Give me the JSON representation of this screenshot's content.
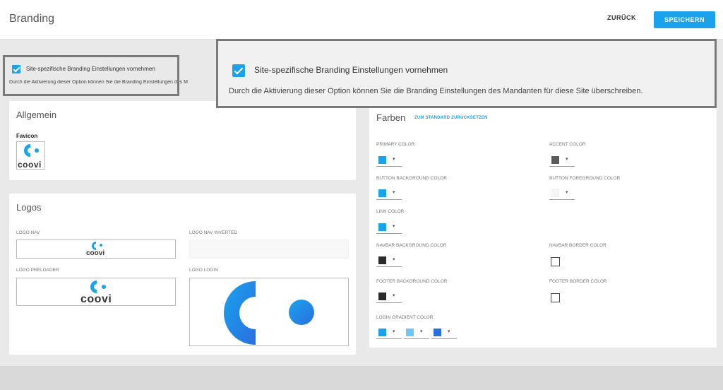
{
  "header": {
    "title": "Branding",
    "back_label": "ZURÜCK",
    "save_label": "SPEICHERN"
  },
  "option": {
    "label": "Site-spezifische Branding Einstellungen vornehmen",
    "desc_truncated": "Durch die Aktivierung dieser Option können Sie die Branding Einstellungen des M",
    "desc": "Durch die Aktivierung dieser Option können Sie die Branding Einstellungen des Mandanten für diese Site überschreiben.",
    "checked": true
  },
  "allgemein": {
    "title": "Allgemein",
    "favicon_label": "Favicon",
    "favicon_text": "coovi"
  },
  "logos": {
    "title": "Logos",
    "logo_nav_label": "LOGO NAV",
    "logo_nav_inverted_label": "LOGO NAV INVERTED",
    "logo_preloader_label": "LOGO PRELOADER",
    "logo_login_label": "LOGO LOGIN",
    "logo_text": "coovi"
  },
  "farben": {
    "title": "Farben",
    "reset_label": "ZUM STANDARD ZURÜCKSETZEN",
    "primary_label": "PRIMARY COLOR",
    "accent_label": "ACCENT COLOR",
    "button_bg_label": "BUTTON BACKGROUND COLOR",
    "button_fg_label": "BUTTON FOREGROUND COLOR",
    "link_label": "LINK COLOR",
    "navbar_bg_label": "NAVBAR BACKGROUND COLOR",
    "navbar_border_label": "NAVBAR BORDER COLOR",
    "footer_bg_label": "FOOTER BACKGROUND COLOR",
    "footer_border_label": "FOOTER BORDER COLOR",
    "login_gradient_label": "LOGIN GRADIENT COLOR",
    "colors": {
      "primary": "#1aa3ec",
      "accent": "#5c5c5c",
      "button_bg": "#1aa3ec",
      "button_fg": "#f5f5f5",
      "link": "#1aa3ec",
      "navbar_bg": "#2b2b2b",
      "footer_bg": "#2b2b2b",
      "gradient_1": "#1aa3ec",
      "gradient_2": "#6ec6f5",
      "gradient_3": "#2a6fe0"
    },
    "caret": "▾"
  }
}
